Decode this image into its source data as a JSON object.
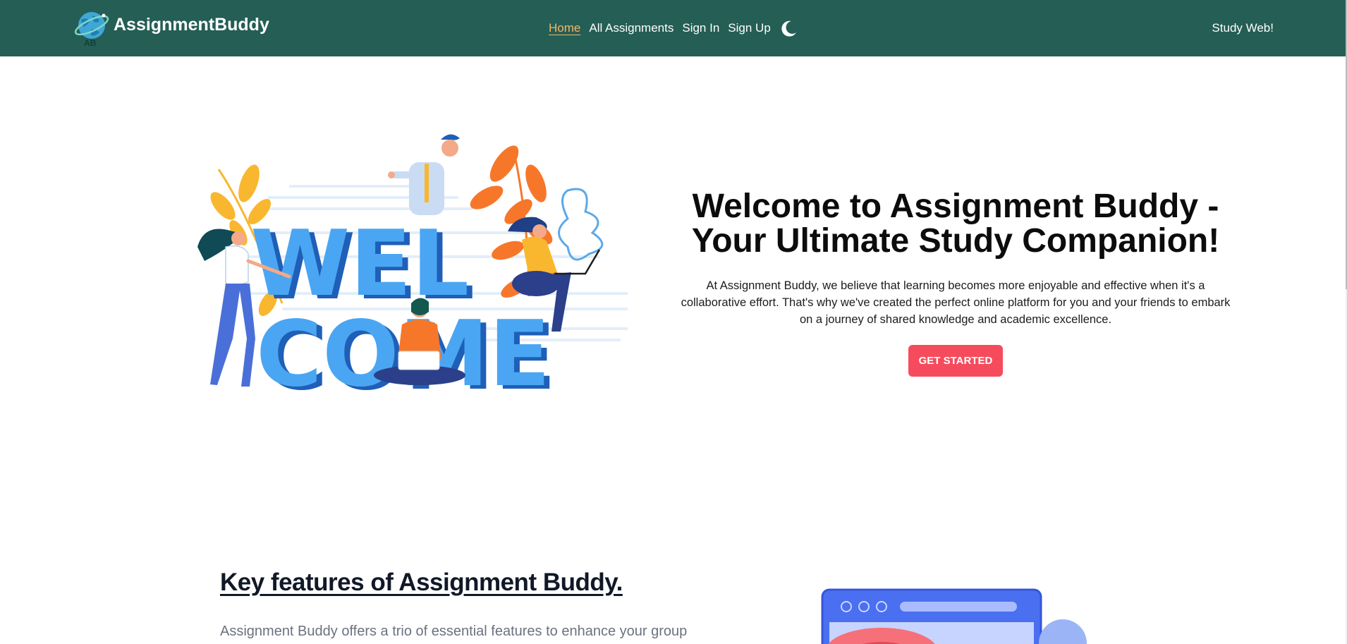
{
  "brand": {
    "name": "AssignmentBuddy",
    "logo_text": "AB",
    "logo_icon": "globe-logo-icon"
  },
  "nav": {
    "links": [
      {
        "label": "Home",
        "active": true
      },
      {
        "label": "All Assignments",
        "active": false
      },
      {
        "label": "Sign In",
        "active": false
      },
      {
        "label": "Sign Up",
        "active": false
      }
    ],
    "theme_icon": "moon-icon",
    "right_label": "Study Web!"
  },
  "hero": {
    "illustration_text": [
      "WEL",
      "COME"
    ],
    "title": "Welcome to Assignment Buddy - Your Ultimate Study Companion!",
    "description": "At Assignment Buddy, we believe that learning becomes more enjoyable and effective when it's a collaborative effort. That's why we've created the perfect online platform for you and your friends to embark on a journey of shared knowledge and academic excellence.",
    "cta_label": "GET STARTED"
  },
  "features": {
    "title": "Key features of Assignment Buddy.",
    "description": "Assignment Buddy offers a trio of essential features to enhance your group"
  },
  "colors": {
    "navbar": "#245e55",
    "active_link": "#f5b666",
    "cta": "#f64b5c",
    "welcome_blue": "#4aa6f2",
    "welcome_shadow": "#1f5fb8",
    "leaf_orange": "#f7772a",
    "leaf_yellow": "#f9b730"
  }
}
